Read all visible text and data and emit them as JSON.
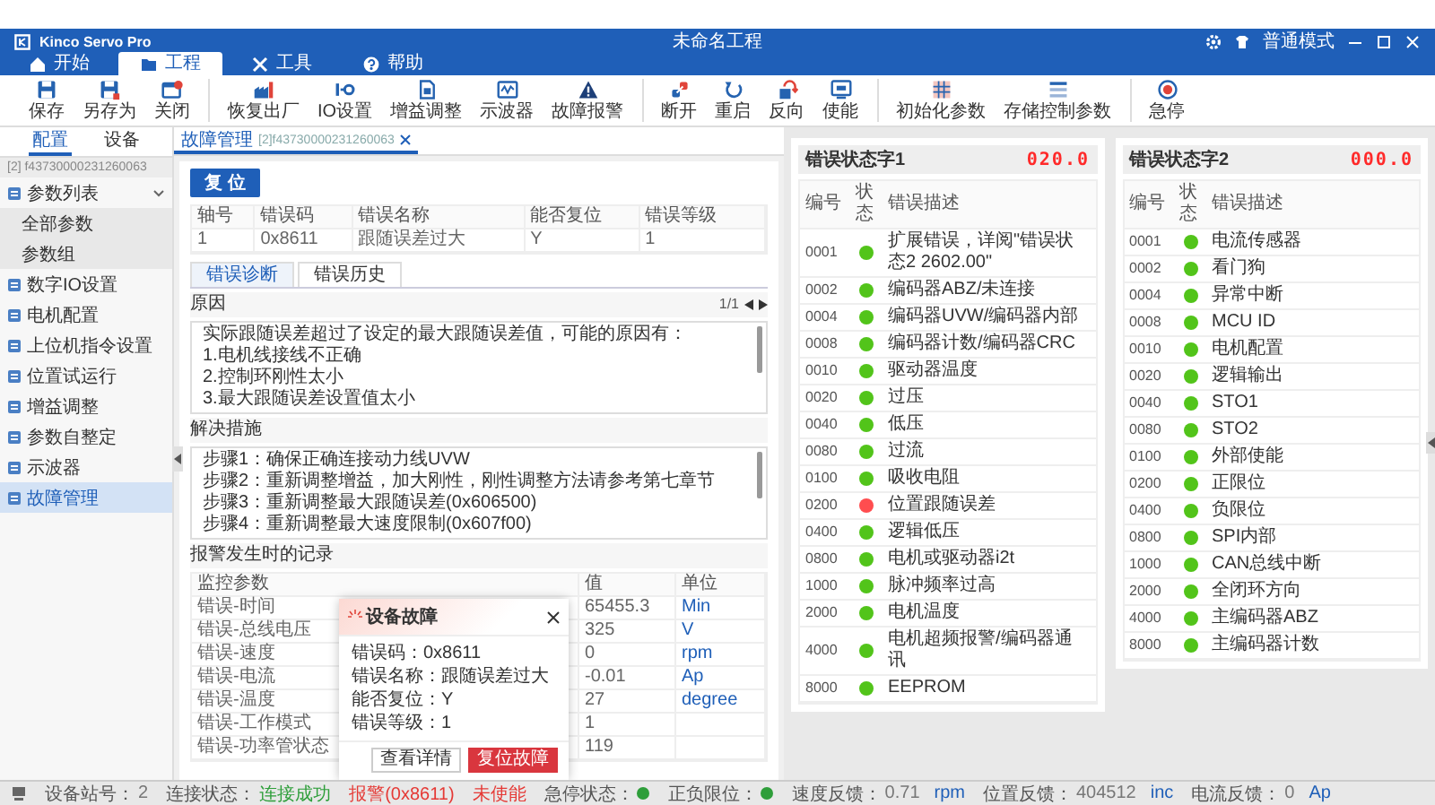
{
  "title_bar": {
    "app_name": "Kinco Servo Pro",
    "project": "未命名工程",
    "mode": "普通模式"
  },
  "ribbon_tabs": [
    {
      "label": "开始",
      "kind": "home",
      "selected": false
    },
    {
      "label": "工程",
      "kind": "folder",
      "selected": true
    },
    {
      "label": "工具",
      "kind": "tools",
      "selected": false
    },
    {
      "label": "帮助",
      "kind": "help",
      "selected": false
    }
  ],
  "toolbar": [
    [
      {
        "label": "保存",
        "kind": "save"
      },
      {
        "label": "另存为",
        "kind": "saveas"
      },
      {
        "label": "关闭",
        "kind": "close"
      }
    ],
    [
      {
        "label": "恢复出厂",
        "kind": "factory"
      },
      {
        "label": "IO设置",
        "kind": "io"
      },
      {
        "label": "增益调整",
        "kind": "gain"
      },
      {
        "label": "示波器",
        "kind": "scope"
      },
      {
        "label": "故障报警",
        "kind": "alarm"
      }
    ],
    [
      {
        "label": "断开",
        "kind": "disconnect"
      },
      {
        "label": "重启",
        "kind": "restart"
      },
      {
        "label": "反向",
        "kind": "reverse"
      },
      {
        "label": "使能",
        "kind": "enable"
      }
    ],
    [
      {
        "label": "初始化参数",
        "kind": "init"
      },
      {
        "label": "存储控制参数",
        "kind": "store"
      }
    ],
    [
      {
        "label": "急停",
        "kind": "estop"
      }
    ]
  ],
  "sidebar": {
    "tabs": [
      {
        "label": "配置",
        "selected": true
      },
      {
        "label": "设备",
        "selected": false
      }
    ],
    "device": "[2] f43730000231260063",
    "items": [
      {
        "label": "参数列表",
        "expanded": true,
        "selected": false,
        "children": [
          {
            "label": "全部参数",
            "expanded": false,
            "selected": false
          },
          {
            "label": "参数组",
            "expanded": false,
            "selected": false
          }
        ]
      },
      {
        "label": "数字IO设置",
        "expanded": false,
        "selected": false
      },
      {
        "label": "电机配置",
        "expanded": false,
        "selected": false
      },
      {
        "label": "上位机指令设置",
        "expanded": false,
        "selected": false
      },
      {
        "label": "位置试运行",
        "expanded": false,
        "selected": false
      },
      {
        "label": "增益调整",
        "expanded": false,
        "selected": false
      },
      {
        "label": "参数自整定",
        "expanded": false,
        "selected": false
      },
      {
        "label": "示波器",
        "expanded": false,
        "selected": false
      },
      {
        "label": "故障管理",
        "expanded": false,
        "selected": true
      }
    ]
  },
  "document_tab": {
    "title": "故障管理",
    "subtitle": "[2]f43730000231260063"
  },
  "reset_button": "复 位",
  "error_table": {
    "columns": [
      "轴号",
      "错误码",
      "错误名称",
      "能否复位",
      "错误等级"
    ],
    "rows": [
      [
        "1",
        "0x8611",
        "跟随误差过大",
        "Y",
        "1"
      ]
    ]
  },
  "detail_tabs": [
    {
      "label": "错误诊断",
      "selected": true
    },
    {
      "label": "错误历史",
      "selected": false
    }
  ],
  "cause": {
    "title": "原因",
    "pager": "1/1",
    "lines": [
      "实际跟随误差超过了设定的最大跟随误差值，可能的原因有：",
      "1.电机线接线不正确",
      "2.控制环刚性太小",
      "3.最大跟随误差设置值太小"
    ]
  },
  "solution": {
    "title": "解决措施",
    "lines": [
      "步骤1：确保正确连接动力线UVW",
      "步骤2：重新调整增益，加大刚性，刚性调整方法请参考第七章节",
      "步骤3：重新调整最大跟随误差(0x606500)",
      "步骤4：重新调整最大速度限制(0x607f00)"
    ]
  },
  "records": {
    "title": "报警发生时的记录",
    "columns": [
      "监控参数",
      "值",
      "单位"
    ],
    "rows": [
      {
        "param": "错误-时间",
        "value": "65455.3",
        "unit": "Min"
      },
      {
        "param": "错误-总线电压",
        "value": "325",
        "unit": "V"
      },
      {
        "param": "错误-速度",
        "value": "0",
        "unit": "rpm"
      },
      {
        "param": "错误-电流",
        "value": "-0.01",
        "unit": "Ap"
      },
      {
        "param": "错误-温度",
        "value": "27",
        "unit": "degree"
      },
      {
        "param": "错误-工作模式",
        "value": "1"
      },
      {
        "param": "错误-功率管状态",
        "value": "119"
      }
    ]
  },
  "dialog": {
    "title": "设备故障",
    "lines": [
      "错误码：0x8611",
      "错误名称：跟随误差过大",
      "能否复位：Y",
      "错误等级：1"
    ],
    "buttons": [
      {
        "label": "查看详情",
        "kind": "default"
      },
      {
        "label": "复位故障",
        "kind": "danger"
      }
    ]
  },
  "status_panels": [
    {
      "title": "错误状态字1",
      "value": "020.0",
      "columns": [
        "编号",
        "状态",
        "错误描述"
      ],
      "rows": [
        {
          "code": "0001",
          "color": "#52c41a",
          "description": "扩展错误，详阅\"错误状态2 2602.00\""
        },
        {
          "code": "0002",
          "color": "#52c41a",
          "description": "编码器ABZ/未连接"
        },
        {
          "code": "0004",
          "color": "#52c41a",
          "description": "编码器UVW/编码器内部"
        },
        {
          "code": "0008",
          "color": "#52c41a",
          "description": "编码器计数/编码器CRC"
        },
        {
          "code": "0010",
          "color": "#52c41a",
          "description": "驱动器温度"
        },
        {
          "code": "0020",
          "color": "#52c41a",
          "description": "过压"
        },
        {
          "code": "0040",
          "color": "#52c41a",
          "description": "低压"
        },
        {
          "code": "0080",
          "color": "#52c41a",
          "description": "过流"
        },
        {
          "code": "0100",
          "color": "#52c41a",
          "description": "吸收电阻"
        },
        {
          "code": "0200",
          "color": "#ff4d4f",
          "description": "位置跟随误差"
        },
        {
          "code": "0400",
          "color": "#52c41a",
          "description": "逻辑低压"
        },
        {
          "code": "0800",
          "color": "#52c41a",
          "description": "电机或驱动器i2t"
        },
        {
          "code": "1000",
          "color": "#52c41a",
          "description": "脉冲频率过高"
        },
        {
          "code": "2000",
          "color": "#52c41a",
          "description": "电机温度"
        },
        {
          "code": "4000",
          "color": "#52c41a",
          "description": "电机超频报警/编码器通讯"
        },
        {
          "code": "8000",
          "color": "#52c41a",
          "description": "EEPROM"
        }
      ]
    },
    {
      "title": "错误状态字2",
      "value": "000.0",
      "columns": [
        "编号",
        "状态",
        "错误描述"
      ],
      "rows": [
        {
          "code": "0001",
          "color": "#52c41a",
          "description": "电流传感器"
        },
        {
          "code": "0002",
          "color": "#52c41a",
          "description": "看门狗"
        },
        {
          "code": "0004",
          "color": "#52c41a",
          "description": "异常中断"
        },
        {
          "code": "0008",
          "color": "#52c41a",
          "description": "MCU ID"
        },
        {
          "code": "0010",
          "color": "#52c41a",
          "description": "电机配置"
        },
        {
          "code": "0020",
          "color": "#52c41a",
          "description": "逻辑输出"
        },
        {
          "code": "0040",
          "color": "#52c41a",
          "description": "STO1"
        },
        {
          "code": "0080",
          "color": "#52c41a",
          "description": "STO2"
        },
        {
          "code": "0100",
          "color": "#52c41a",
          "description": "外部使能"
        },
        {
          "code": "0200",
          "color": "#52c41a",
          "description": "正限位"
        },
        {
          "code": "0400",
          "color": "#52c41a",
          "description": "负限位"
        },
        {
          "code": "0800",
          "color": "#52c41a",
          "description": "SPI内部"
        },
        {
          "code": "1000",
          "color": "#52c41a",
          "description": "CAN总线中断"
        },
        {
          "code": "2000",
          "color": "#52c41a",
          "description": "全闭环方向"
        },
        {
          "code": "4000",
          "color": "#52c41a",
          "description": "主编码器ABZ"
        },
        {
          "code": "8000",
          "color": "#52c41a",
          "description": "主编码器计数"
        }
      ]
    }
  ],
  "status_bar": [
    {
      "kind": "field",
      "label": "设备站号：",
      "value": "2"
    },
    {
      "kind": "field",
      "label": "连接状态：",
      "value": "连接成功",
      "color": "#2e9e3a"
    },
    {
      "kind": "alert",
      "value": "报警(0x8611)",
      "color": "#e53935"
    },
    {
      "kind": "alert",
      "value": "未使能",
      "color": "#e53935"
    },
    {
      "kind": "dot",
      "label": "急停状态：",
      "color": "#2e9e3a"
    },
    {
      "kind": "dot",
      "label": "正负限位：",
      "color": "#2e9e3a"
    },
    {
      "kind": "reading",
      "label": "速度反馈：",
      "value": "0.71",
      "unit": "rpm"
    },
    {
      "kind": "reading",
      "label": "位置反馈：",
      "value": "404512",
      "unit": "inc"
    },
    {
      "kind": "reading",
      "label": "电流反馈：",
      "value": "0",
      "unit": "Ap"
    }
  ]
}
